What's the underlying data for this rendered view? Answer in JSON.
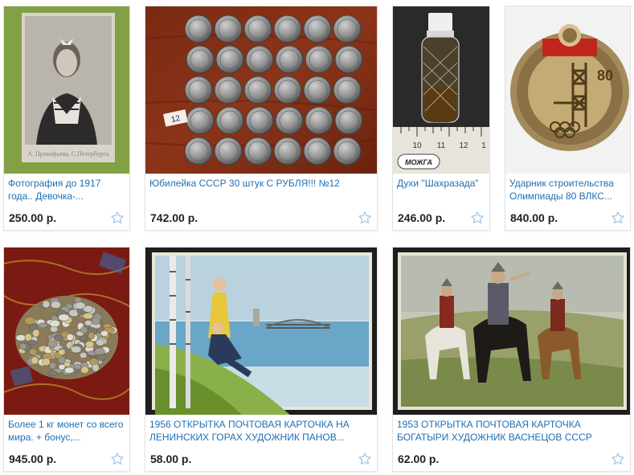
{
  "accent_link_color": "#1e6fb3",
  "price_color": "#222222",
  "star_color": "#9ec3e6",
  "items": [
    {
      "title": "Фотография до 1917 года.. Девочка-...",
      "price": "250.00 р.",
      "favorite_icon": "star-outline-icon"
    },
    {
      "title": "Юбилейка СССР 30 штук С РУБЛЯ!!! №12",
      "price": "742.00 р.",
      "favorite_icon": "star-outline-icon",
      "handwritten_tag": "12"
    },
    {
      "title": "Духи \"Шахразада\"",
      "price": "246.00 р.",
      "favorite_icon": "star-outline-icon",
      "ruler_label": "МОЖГА",
      "ruler_numbers": [
        "10",
        "11",
        "12",
        "1"
      ]
    },
    {
      "title": "Ударник строительства Олимпиады 80 ВЛКС...",
      "price": "840.00 р.",
      "favorite_icon": "star-outline-icon"
    },
    {
      "title": "Более 1 кг монет со всего мира. + бонус,...",
      "price": "945.00 р.",
      "favorite_icon": "star-outline-icon"
    },
    {
      "title": "1956 ОТКРЫТКА ПОЧТОВАЯ КАРТОЧКА НА ЛЕНИНСКИХ ГОРАХ ХУДОЖНИК ПАНОВ...",
      "price": "58.00 р.",
      "favorite_icon": "star-outline-icon"
    },
    {
      "title": "1953 ОТКРЫТКА ПОЧТОВАЯ КАРТОЧКА БОГАТЫРИ ХУДОЖНИК ВАСНЕЦОВ СССР",
      "price": "62.00 р.",
      "favorite_icon": "star-outline-icon"
    }
  ]
}
